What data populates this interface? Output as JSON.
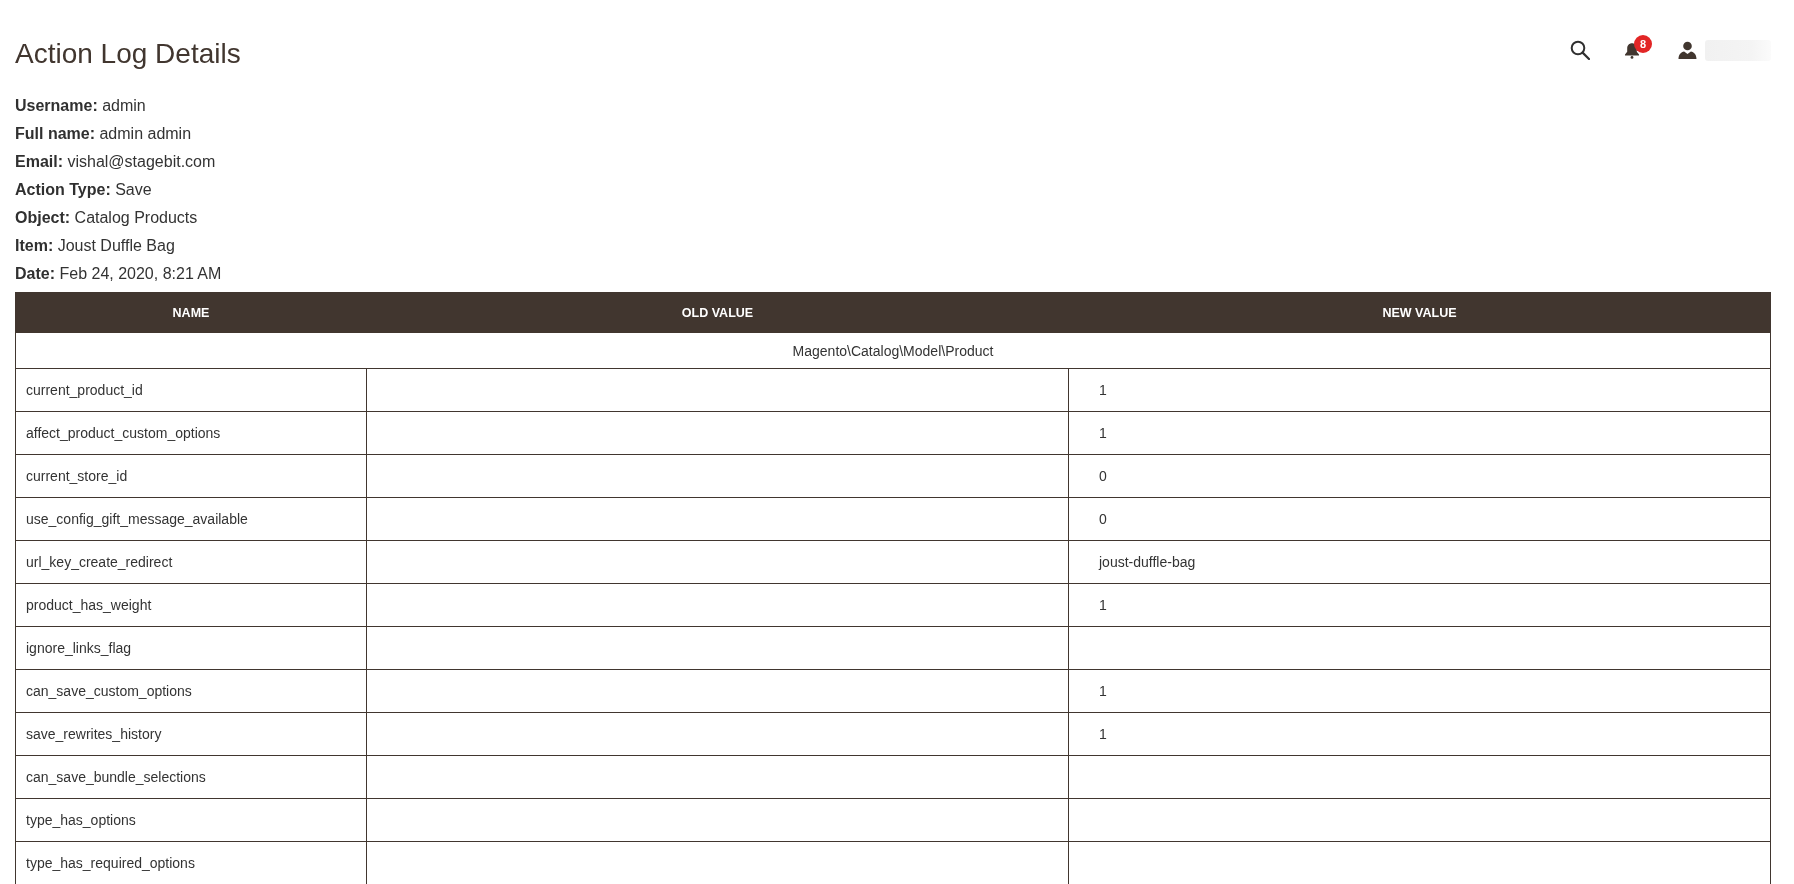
{
  "header": {
    "title": "Action Log Details",
    "notifications": {
      "count": "8"
    }
  },
  "details": [
    {
      "label": "Username:",
      "value": "admin"
    },
    {
      "label": "Full name:",
      "value": "admin admin"
    },
    {
      "label": "Email:",
      "value": "vishal@stagebit.com"
    },
    {
      "label": "Action Type:",
      "value": "Save"
    },
    {
      "label": "Object:",
      "value": "Catalog Products"
    },
    {
      "label": "Item:",
      "value": "Joust Duffle Bag"
    },
    {
      "label": "Date:",
      "value": "Feb 24, 2020, 8:21 AM"
    }
  ],
  "table": {
    "columns": [
      "NAME",
      "OLD VALUE",
      "NEW VALUE"
    ],
    "group_label": "Magento\\Catalog\\Model\\Product",
    "rows": [
      {
        "name": "current_product_id",
        "new_value": "1"
      },
      {
        "name": "affect_product_custom_options",
        "new_value": "1"
      },
      {
        "name": "current_store_id",
        "new_value": "0"
      },
      {
        "name": "use_config_gift_message_available",
        "new_value": "0"
      },
      {
        "name": "url_key_create_redirect",
        "new_value": "joust-duffle-bag"
      },
      {
        "name": "product_has_weight",
        "new_value": "1"
      },
      {
        "name": "ignore_links_flag"
      },
      {
        "name": "can_save_custom_options",
        "new_value": "1"
      },
      {
        "name": "save_rewrites_history",
        "new_value": "1"
      },
      {
        "name": "can_save_bundle_selections"
      },
      {
        "name": "type_has_options"
      },
      {
        "name": "type_has_required_options"
      }
    ]
  }
}
